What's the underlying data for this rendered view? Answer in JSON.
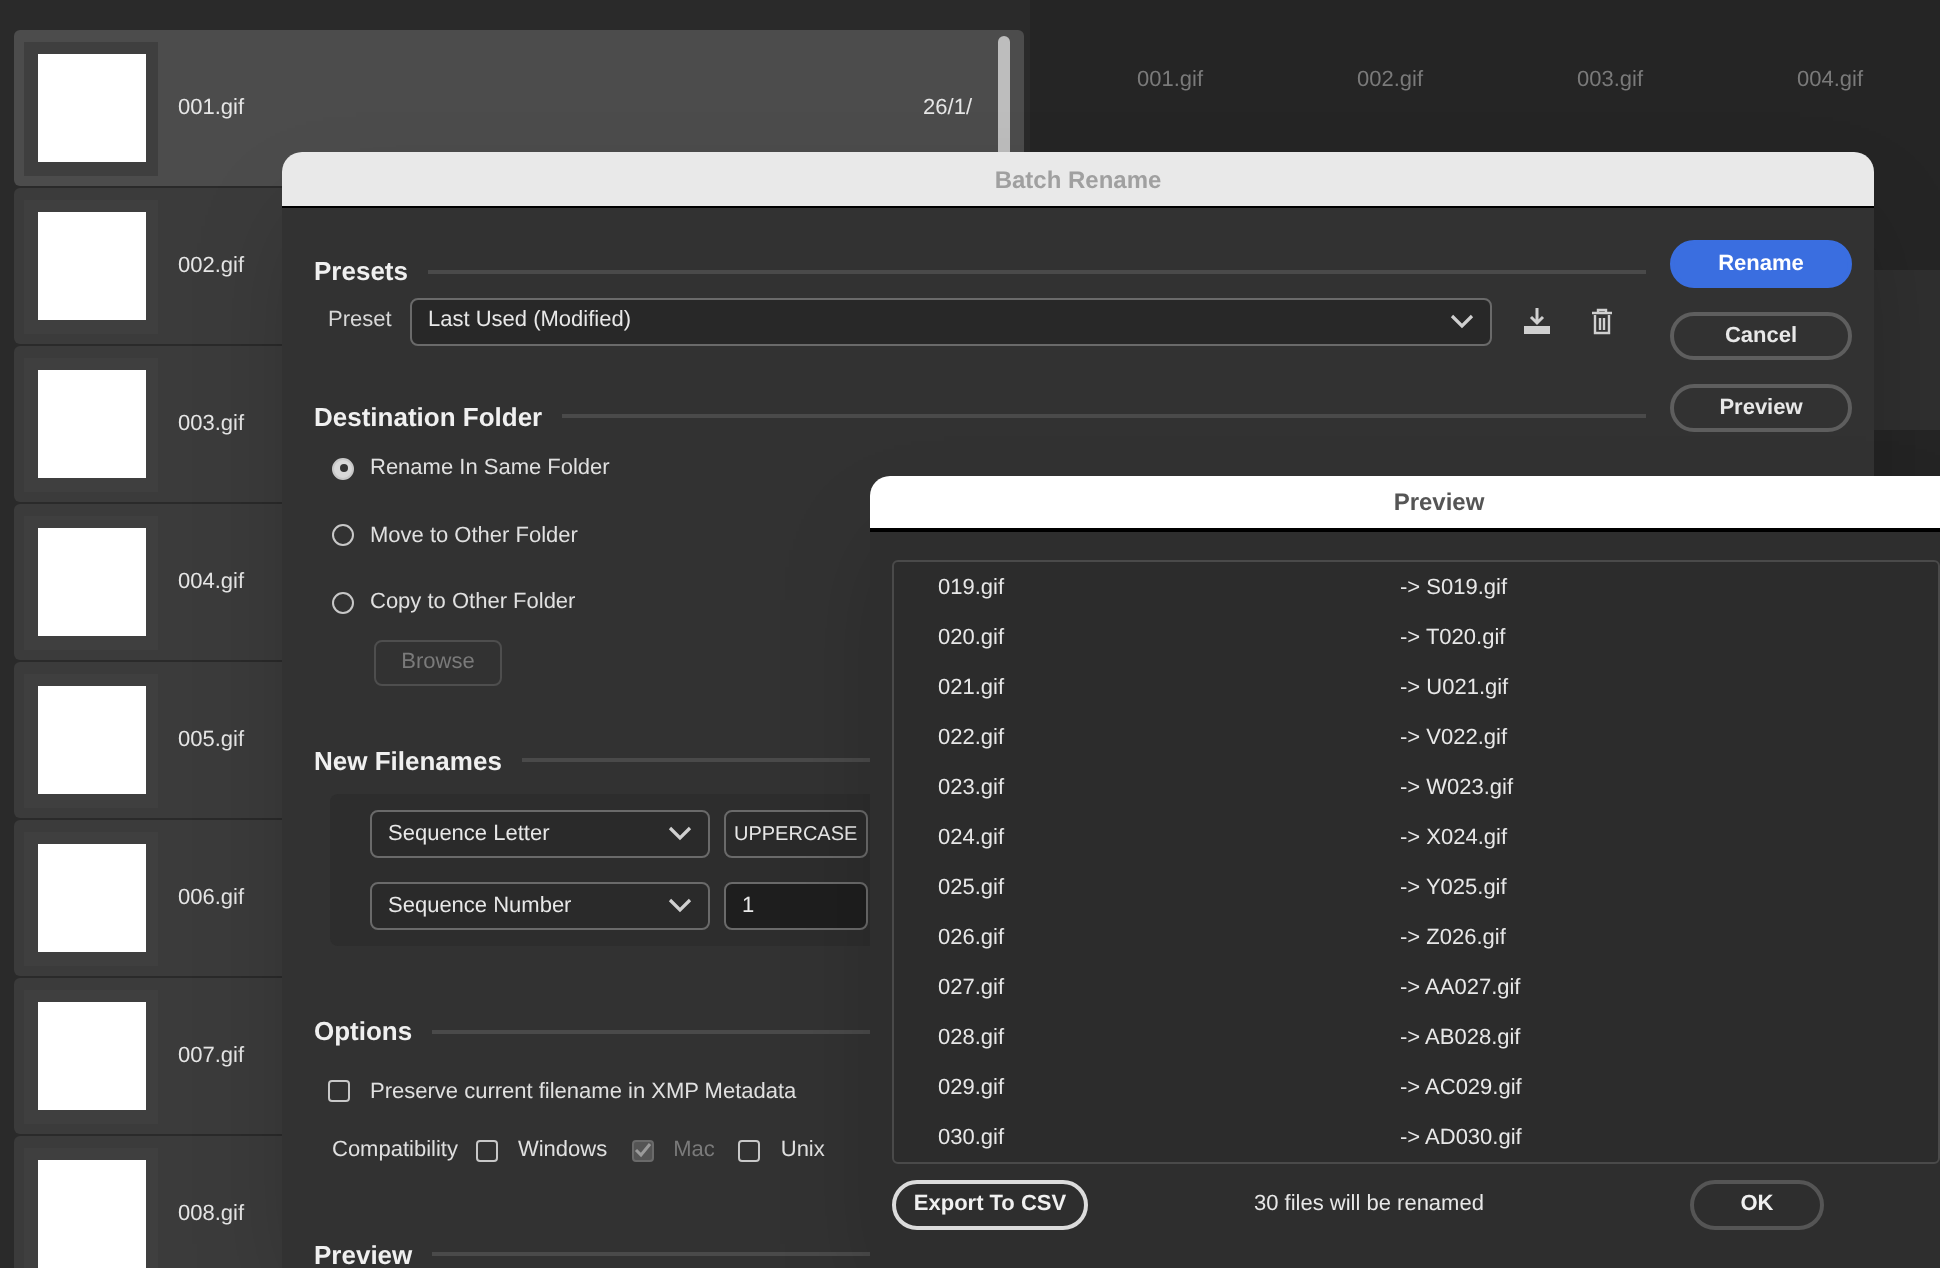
{
  "browser": {
    "files": [
      {
        "name": "001.gif",
        "date": "26/1/",
        "selected": true
      },
      {
        "name": "002.gif",
        "selected": false
      },
      {
        "name": "003.gif",
        "selected": false
      },
      {
        "name": "004.gif",
        "selected": false
      },
      {
        "name": "005.gif",
        "selected": false
      },
      {
        "name": "006.gif",
        "selected": false
      },
      {
        "name": "007.gif",
        "selected": false
      },
      {
        "name": "008.gif",
        "selected": false
      }
    ]
  },
  "content_grid": {
    "items": [
      "001.gif",
      "002.gif",
      "003.gif",
      "004.gif"
    ]
  },
  "batch_rename": {
    "title": "Batch Rename",
    "presets": {
      "heading": "Presets",
      "label": "Preset",
      "value": "Last Used (Modified)"
    },
    "buttons": [
      {
        "label": "Rename",
        "kind": "primary"
      },
      {
        "label": "Cancel",
        "kind": "secondary"
      },
      {
        "label": "Preview",
        "kind": "secondary"
      }
    ],
    "destination": {
      "heading": "Destination Folder",
      "options": [
        {
          "label": "Rename In Same Folder",
          "selected": true
        },
        {
          "label": "Move to Other Folder",
          "selected": false
        },
        {
          "label": "Copy to Other Folder",
          "selected": false
        }
      ],
      "browse": {
        "label": "Browse",
        "disabled": true
      }
    },
    "new_filenames": {
      "heading": "New Filenames",
      "rows": [
        {
          "type": "Sequence Letter",
          "option": "UPPERCASE",
          "kind": "dropdown"
        },
        {
          "type": "Sequence Number",
          "option": "1",
          "kind": "field"
        }
      ]
    },
    "options": {
      "heading": "Options",
      "preserve": {
        "label": "Preserve current filename in XMP Metadata",
        "checked": false
      },
      "compatibility_label": "Compatibility",
      "compatibility": [
        {
          "label": "Windows",
          "checked": false,
          "disabled": false
        },
        {
          "label": "Mac",
          "checked": true,
          "disabled": true
        },
        {
          "label": "Unix",
          "checked": false,
          "disabled": false
        }
      ]
    },
    "preview_heading": "Preview"
  },
  "preview_dialog": {
    "title": "Preview",
    "rows": [
      {
        "from": "019.gif",
        "to": "-> S019.gif"
      },
      {
        "from": "020.gif",
        "to": "-> T020.gif"
      },
      {
        "from": "021.gif",
        "to": "-> U021.gif"
      },
      {
        "from": "022.gif",
        "to": "-> V022.gif"
      },
      {
        "from": "023.gif",
        "to": "-> W023.gif"
      },
      {
        "from": "024.gif",
        "to": "-> X024.gif"
      },
      {
        "from": "025.gif",
        "to": "-> Y025.gif"
      },
      {
        "from": "026.gif",
        "to": "-> Z026.gif"
      },
      {
        "from": "027.gif",
        "to": "-> AA027.gif"
      },
      {
        "from": "028.gif",
        "to": "-> AB028.gif"
      },
      {
        "from": "029.gif",
        "to": "-> AC029.gif"
      },
      {
        "from": "030.gif",
        "to": "-> AD030.gif"
      }
    ],
    "export_button": "Export To CSV",
    "summary": "30 files will be renamed",
    "ok_button": "OK"
  }
}
